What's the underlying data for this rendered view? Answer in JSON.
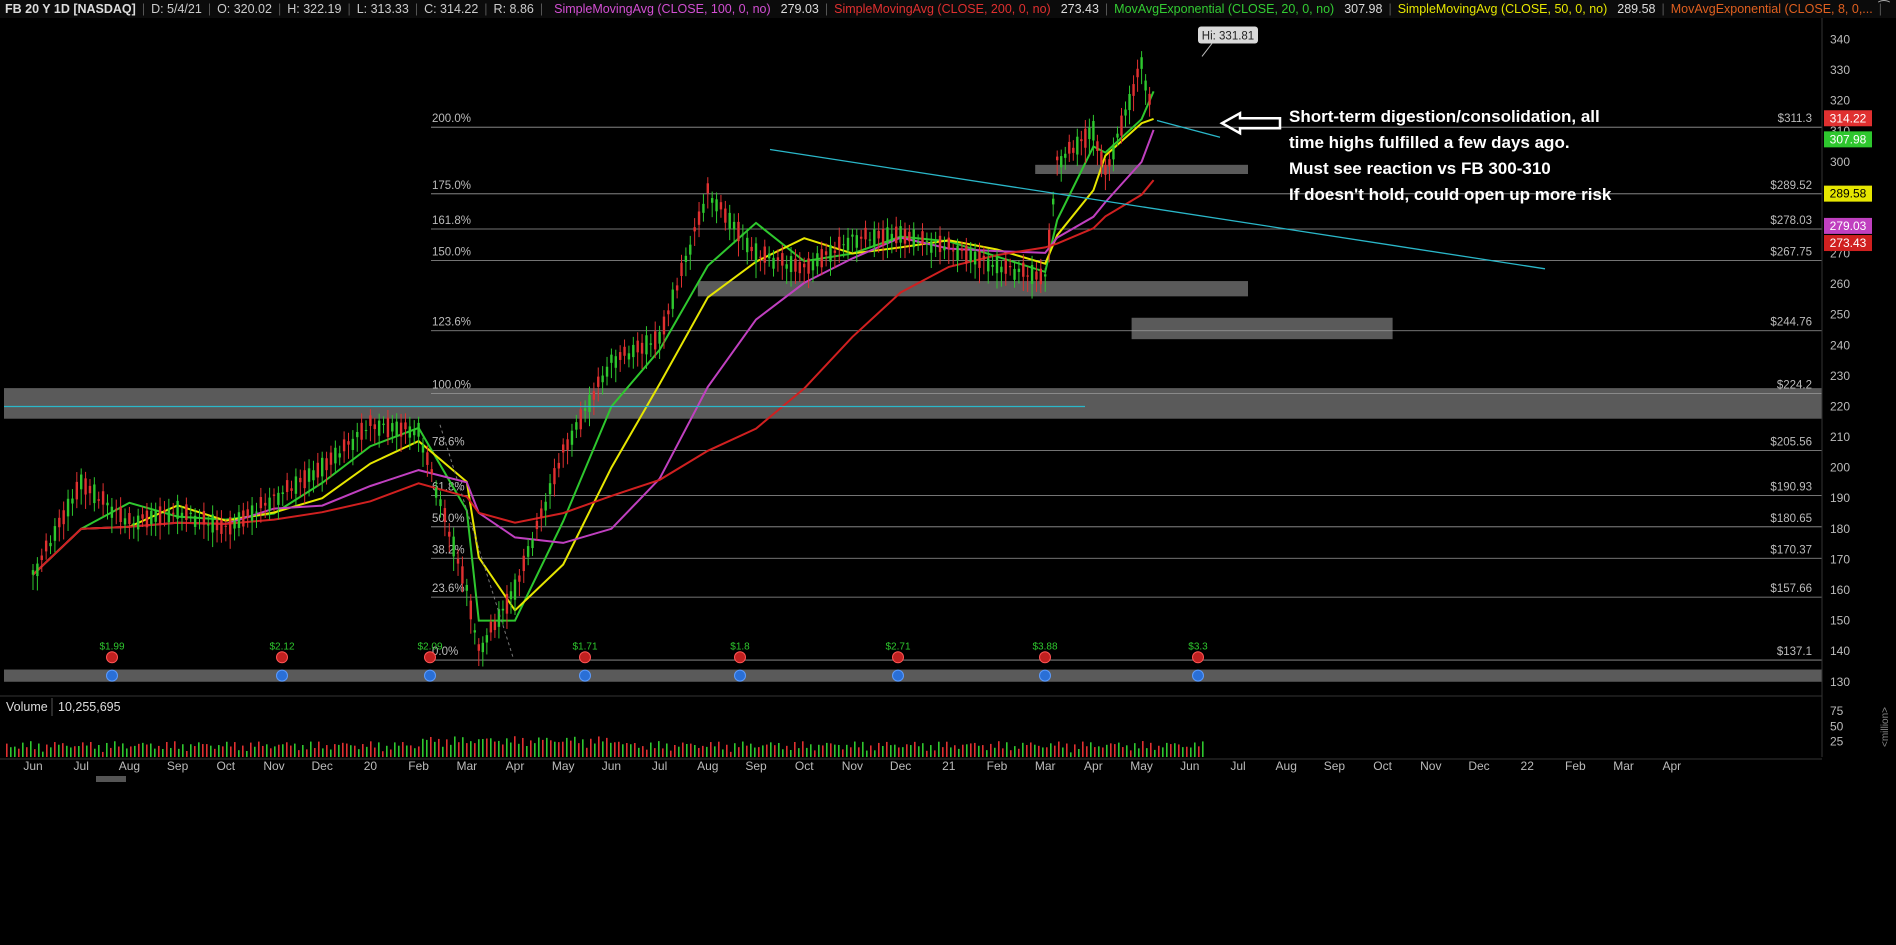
{
  "header": {
    "symbol": "FB 20 Y 1D [NASDAQ]",
    "date": "D: 5/4/21",
    "open": "O: 320.02",
    "high": "H: 322.19",
    "low": "L: 313.33",
    "close": "C: 314.22",
    "range": "R: 8.86",
    "studies": [
      {
        "label": "SimpleMovingAvg (CLOSE, 100, 0, no)",
        "value": "279.03",
        "color": "#d34fd3"
      },
      {
        "label": "SimpleMovingAvg (CLOSE, 200, 0, no)",
        "value": "273.43",
        "color": "#e03030"
      },
      {
        "label": "MovAvgExponential (CLOSE, 20, 0, no)",
        "value": "307.98",
        "color": "#33cc33"
      },
      {
        "label": "SimpleMovingAvg (CLOSE, 50, 0, no)",
        "value": "289.58",
        "color": "#e6e600"
      },
      {
        "label": "MovAvgExponential (CLOSE, 8, 0,...",
        "value": "",
        "color": "#e06020"
      }
    ]
  },
  "chart_data": {
    "type": "candlestick",
    "symbol": "FB",
    "x_ticks": [
      "Jun",
      "Jul",
      "Aug",
      "Sep",
      "Oct",
      "Nov",
      "Dec",
      "20",
      "Feb",
      "Mar",
      "Apr",
      "May",
      "Jun",
      "Jul",
      "Aug",
      "Sep",
      "Oct",
      "Nov",
      "Dec",
      "21",
      "Feb",
      "Mar",
      "Apr",
      "May",
      "Jun",
      "Jul",
      "Aug",
      "Sep",
      "Oct",
      "Nov",
      "Dec",
      "22",
      "Feb",
      "Mar",
      "Apr"
    ],
    "y_ticks": [
      130,
      140,
      150,
      160,
      170,
      180,
      190,
      200,
      210,
      220,
      230,
      240,
      250,
      260,
      270,
      280,
      290,
      300,
      310,
      320,
      330,
      340
    ],
    "ylim": [
      126,
      347
    ],
    "price_path": [
      [
        "Jun",
        165
      ],
      [
        "Jul",
        195
      ],
      [
        "Aug",
        182
      ],
      [
        "Sep",
        186
      ],
      [
        "Oct",
        180
      ],
      [
        "Nov",
        190
      ],
      [
        "Dec",
        200
      ],
      [
        "20",
        214
      ],
      [
        "Feb",
        212
      ],
      [
        "Mar",
        160
      ],
      [
        "Mar",
        140
      ],
      [
        "Apr",
        160
      ],
      [
        "May",
        205
      ],
      [
        "Jun",
        235
      ],
      [
        "Jul",
        242
      ],
      [
        "Aug",
        290
      ],
      [
        "Sep",
        270
      ],
      [
        "Oct",
        265
      ],
      [
        "Nov",
        275
      ],
      [
        "Dec",
        276
      ],
      [
        "21",
        272
      ],
      [
        "Feb",
        266
      ],
      [
        "Mar",
        262
      ],
      [
        "Mar",
        300
      ],
      [
        "Apr",
        310
      ],
      [
        "Apr",
        296
      ],
      [
        "May",
        331.81
      ],
      [
        "May",
        314.22
      ]
    ],
    "hi_label": "Hi: 331.81",
    "fib_levels": [
      {
        "pct": "200.0%",
        "value": 311.3,
        "label": "$311.3"
      },
      {
        "pct": "175.0%",
        "value": 289.52,
        "label": "$289.52"
      },
      {
        "pct": "161.8%",
        "value": 278.03,
        "label": "$278.03"
      },
      {
        "pct": "150.0%",
        "value": 267.75,
        "label": "$267.75"
      },
      {
        "pct": "123.6%",
        "value": 244.76,
        "label": "$244.76"
      },
      {
        "pct": "100.0%",
        "value": 224.2,
        "label": "$224.2"
      },
      {
        "pct": "78.6%",
        "value": 205.56,
        "label": "$205.56"
      },
      {
        "pct": "61.8%",
        "value": 190.93,
        "label": "$190.93"
      },
      {
        "pct": "50.0%",
        "value": 180.65,
        "label": "$180.65"
      },
      {
        "pct": "38.2%",
        "value": 170.37,
        "label": "$170.37"
      },
      {
        "pct": "23.6%",
        "value": 157.66,
        "label": "$157.66"
      },
      {
        "pct": "0.0%",
        "value": 137.1,
        "label": "$137.1"
      }
    ],
    "price_badges": [
      {
        "value": 314.22,
        "label": "314.22",
        "color": "#e03030"
      },
      {
        "value": 307.98,
        "label": "307.98",
        "color": "#2ec72e"
      },
      {
        "value": 289.58,
        "label": "289.58",
        "color": "#e6e600"
      },
      {
        "value": 279.03,
        "label": "279.03",
        "color": "#c040c0"
      },
      {
        "value": 273.43,
        "label": "273.43",
        "color": "#d02020"
      }
    ],
    "zones": [
      {
        "from": 216,
        "to": 226,
        "x_from": "start",
        "x_to": "end"
      },
      {
        "from": 242,
        "to": 249,
        "x_from": "May",
        "x_to": "Oct"
      },
      {
        "from": 256,
        "to": 261,
        "x_from": "Aug",
        "x_to": "Jul"
      },
      {
        "from": 296,
        "to": 299,
        "x_from": "Mar",
        "x_to": "Jul"
      },
      {
        "from": 130,
        "to": 134,
        "x_from": "start",
        "x_to": "end"
      }
    ],
    "dividends": [
      "$1.99",
      "$2.12",
      "$2.09",
      "$1.71",
      "$1.8",
      "$2.71",
      "$3.88",
      "$3.3"
    ],
    "annotation_lines": [
      "Short-term digestion/consolidation, all",
      "time highs fulfilled a few days ago.",
      "Must see reaction vs FB 300-310",
      "If doesn't hold, could open up more risk"
    ],
    "volume": {
      "label": "Volume",
      "value": "10,255,695",
      "y_ticks": [
        25,
        50,
        75
      ],
      "y_unit": "million"
    }
  }
}
